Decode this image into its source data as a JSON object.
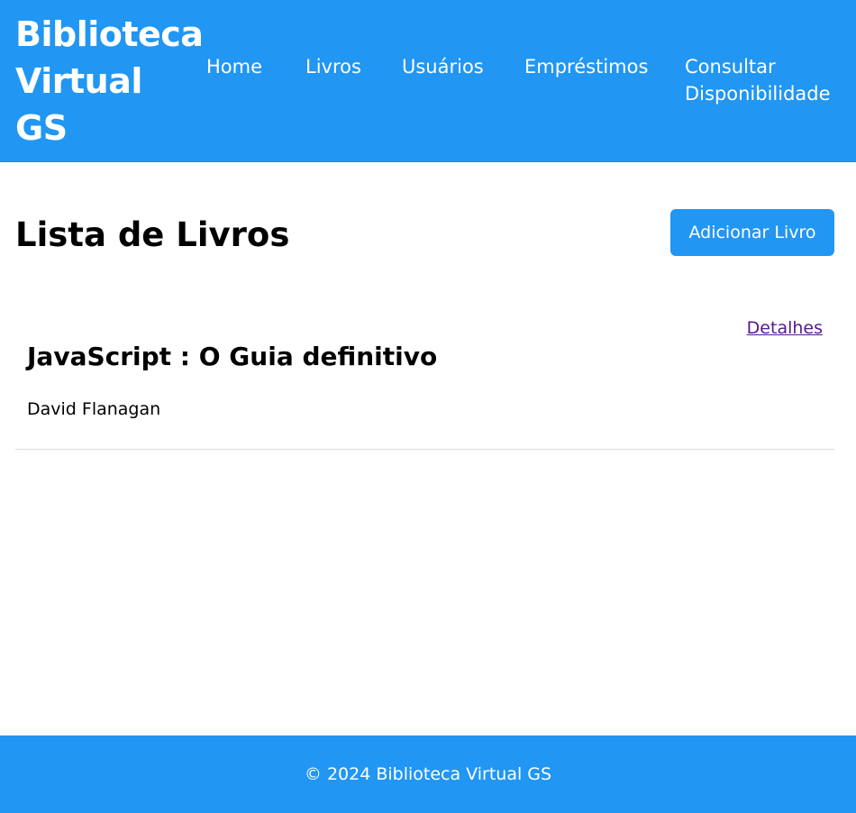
{
  "colors": {
    "primary": "#2196f3",
    "header_text": "#ffffff",
    "visited_link": "#551a8b",
    "divider": "#dddddd"
  },
  "header": {
    "brand_line1": "Biblioteca",
    "brand_line2": "Virtual",
    "brand_line3": "GS",
    "nav": {
      "home": "Home",
      "livros": "Livros",
      "usuarios": "Usuários",
      "emprestimos": "Empréstimos",
      "consultar_line1": "Consultar",
      "consultar_line2": "Disponibilidade"
    }
  },
  "main": {
    "title": "Lista de Livros",
    "add_button": "Adicionar Livro",
    "books": [
      {
        "title": "JavaScript : O Guia definitivo",
        "author": "David Flanagan",
        "details_link": "Detalhes"
      }
    ]
  },
  "footer": {
    "text": "© 2024 Biblioteca Virtual GS"
  }
}
